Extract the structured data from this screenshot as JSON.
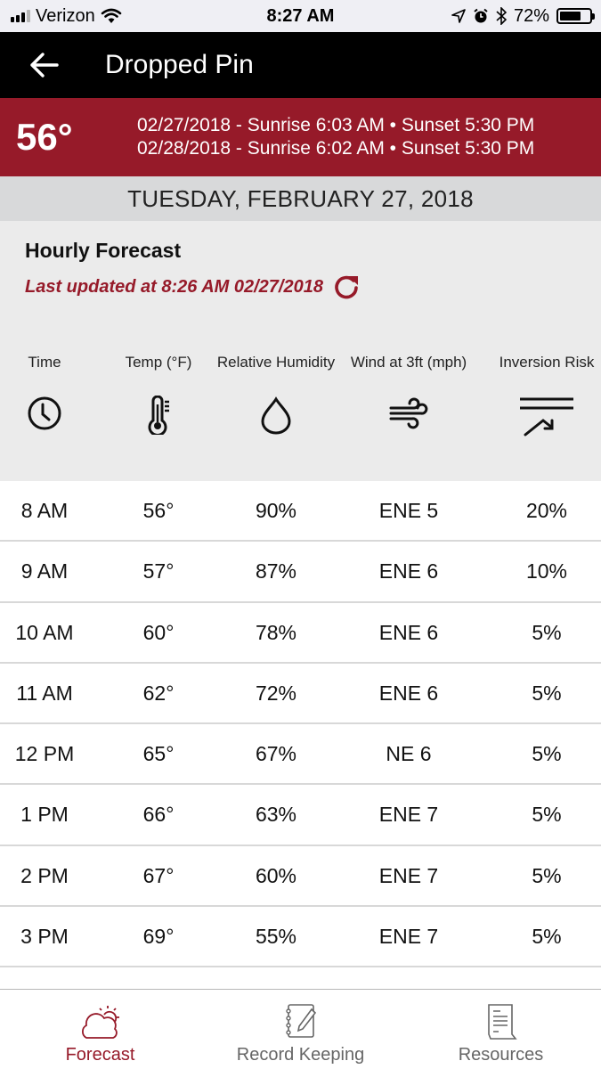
{
  "status_bar": {
    "carrier": "Verizon",
    "time": "8:27 AM",
    "battery": "72%",
    "battery_level": 0.72,
    "icons": [
      "signal-icon",
      "wifi-icon",
      "location-arrow-icon",
      "alarm-icon",
      "bluetooth-icon",
      "battery-icon"
    ]
  },
  "header": {
    "back_icon": "arrow-left-icon",
    "title": "Dropped Pin"
  },
  "banner": {
    "current_temp": "56°",
    "lines": [
      "02/27/2018 - Sunrise 6:03 AM • Sunset 5:30 PM",
      "02/28/2018 - Sunrise 6:02 AM • Sunset 5:30 PM"
    ],
    "color": "#961a29"
  },
  "date_bar": "TUESDAY, FEBRUARY 27, 2018",
  "hourly": {
    "title": "Hourly Forecast",
    "last_updated": "Last updated at 8:26 AM 02/27/2018",
    "refresh_icon": "refresh-icon",
    "columns": [
      {
        "label": "Time",
        "icon": "clock-icon"
      },
      {
        "label": "Temp (°F)",
        "icon": "thermometer-icon"
      },
      {
        "label": "Relative Humidity",
        "icon": "droplet-icon"
      },
      {
        "label": "Wind at 3ft (mph)",
        "icon": "wind-icon"
      },
      {
        "label": "Inversion Risk",
        "icon": "inversion-icon"
      }
    ],
    "rows": [
      {
        "time": "8 AM",
        "temp": "56°",
        "humidity": "90%",
        "wind": "ENE 5",
        "inversion": "20%"
      },
      {
        "time": "9 AM",
        "temp": "57°",
        "humidity": "87%",
        "wind": "ENE 6",
        "inversion": "10%"
      },
      {
        "time": "10 AM",
        "temp": "60°",
        "humidity": "78%",
        "wind": "ENE 6",
        "inversion": "5%"
      },
      {
        "time": "11 AM",
        "temp": "62°",
        "humidity": "72%",
        "wind": "ENE 6",
        "inversion": "5%"
      },
      {
        "time": "12 PM",
        "temp": "65°",
        "humidity": "67%",
        "wind": "NE 6",
        "inversion": "5%"
      },
      {
        "time": "1 PM",
        "temp": "66°",
        "humidity": "63%",
        "wind": "ENE 7",
        "inversion": "5%"
      },
      {
        "time": "2 PM",
        "temp": "67°",
        "humidity": "60%",
        "wind": "ENE 7",
        "inversion": "5%"
      },
      {
        "time": "3 PM",
        "temp": "69°",
        "humidity": "55%",
        "wind": "ENE 7",
        "inversion": "5%"
      }
    ]
  },
  "tab_bar": {
    "tabs": [
      {
        "label": "Forecast",
        "icon": "cloud-sun-icon",
        "active": true
      },
      {
        "label": "Record Keeping",
        "icon": "notebook-pencil-icon",
        "active": false
      },
      {
        "label": "Resources",
        "icon": "document-icon",
        "active": false
      }
    ],
    "active_color": "#961a29"
  }
}
